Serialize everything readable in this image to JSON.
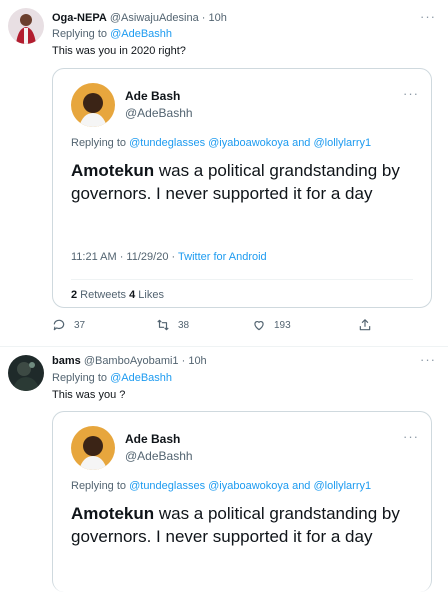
{
  "tweet1": {
    "name": "Oga-NEPA",
    "handle": "@AsiwajuAdesina · 10h",
    "replying_prefix": "Replying to ",
    "replying_user": "@AdeBashh",
    "text": "This was you in 2020 right?",
    "more_icon": "more-icon",
    "quote": {
      "name": "Ade Bash",
      "handle": "@AdeBashh",
      "replying_prefix": "Replying to ",
      "replying_users": "@tundeglasses @iyaboawokoya and @lollylarry1",
      "text_bold": "Amotekun",
      "text_rest": " was a political grandstanding by governors. I never supported it for a day",
      "time": "11:21 AM · 11/29/20 · ",
      "source": "Twitter for Android",
      "retweets_count": "2",
      "retweets_label": " Retweets ",
      "likes_count": "4",
      "likes_label": " Likes"
    },
    "actions": {
      "reply": "37",
      "retweet": "38",
      "like": "193"
    }
  },
  "tweet2": {
    "name": "bams",
    "handle": "@BamboAyobami1 · 10h",
    "replying_prefix": "Replying to ",
    "replying_user": "@AdeBashh",
    "text": "This was you ?",
    "quote": {
      "name": "Ade Bash",
      "handle": "@AdeBashh",
      "replying_prefix": "Replying to ",
      "replying_users": "@tundeglasses @iyaboawokoya and @lollylarry1",
      "text_bold": "Amotekun",
      "text_rest": " was a political grandstanding by governors. I never supported it for a day"
    }
  },
  "colors": {
    "accent": "#1d9bf0",
    "text": "#0f1419",
    "muted": "#536471",
    "border": "#cfd9de"
  }
}
